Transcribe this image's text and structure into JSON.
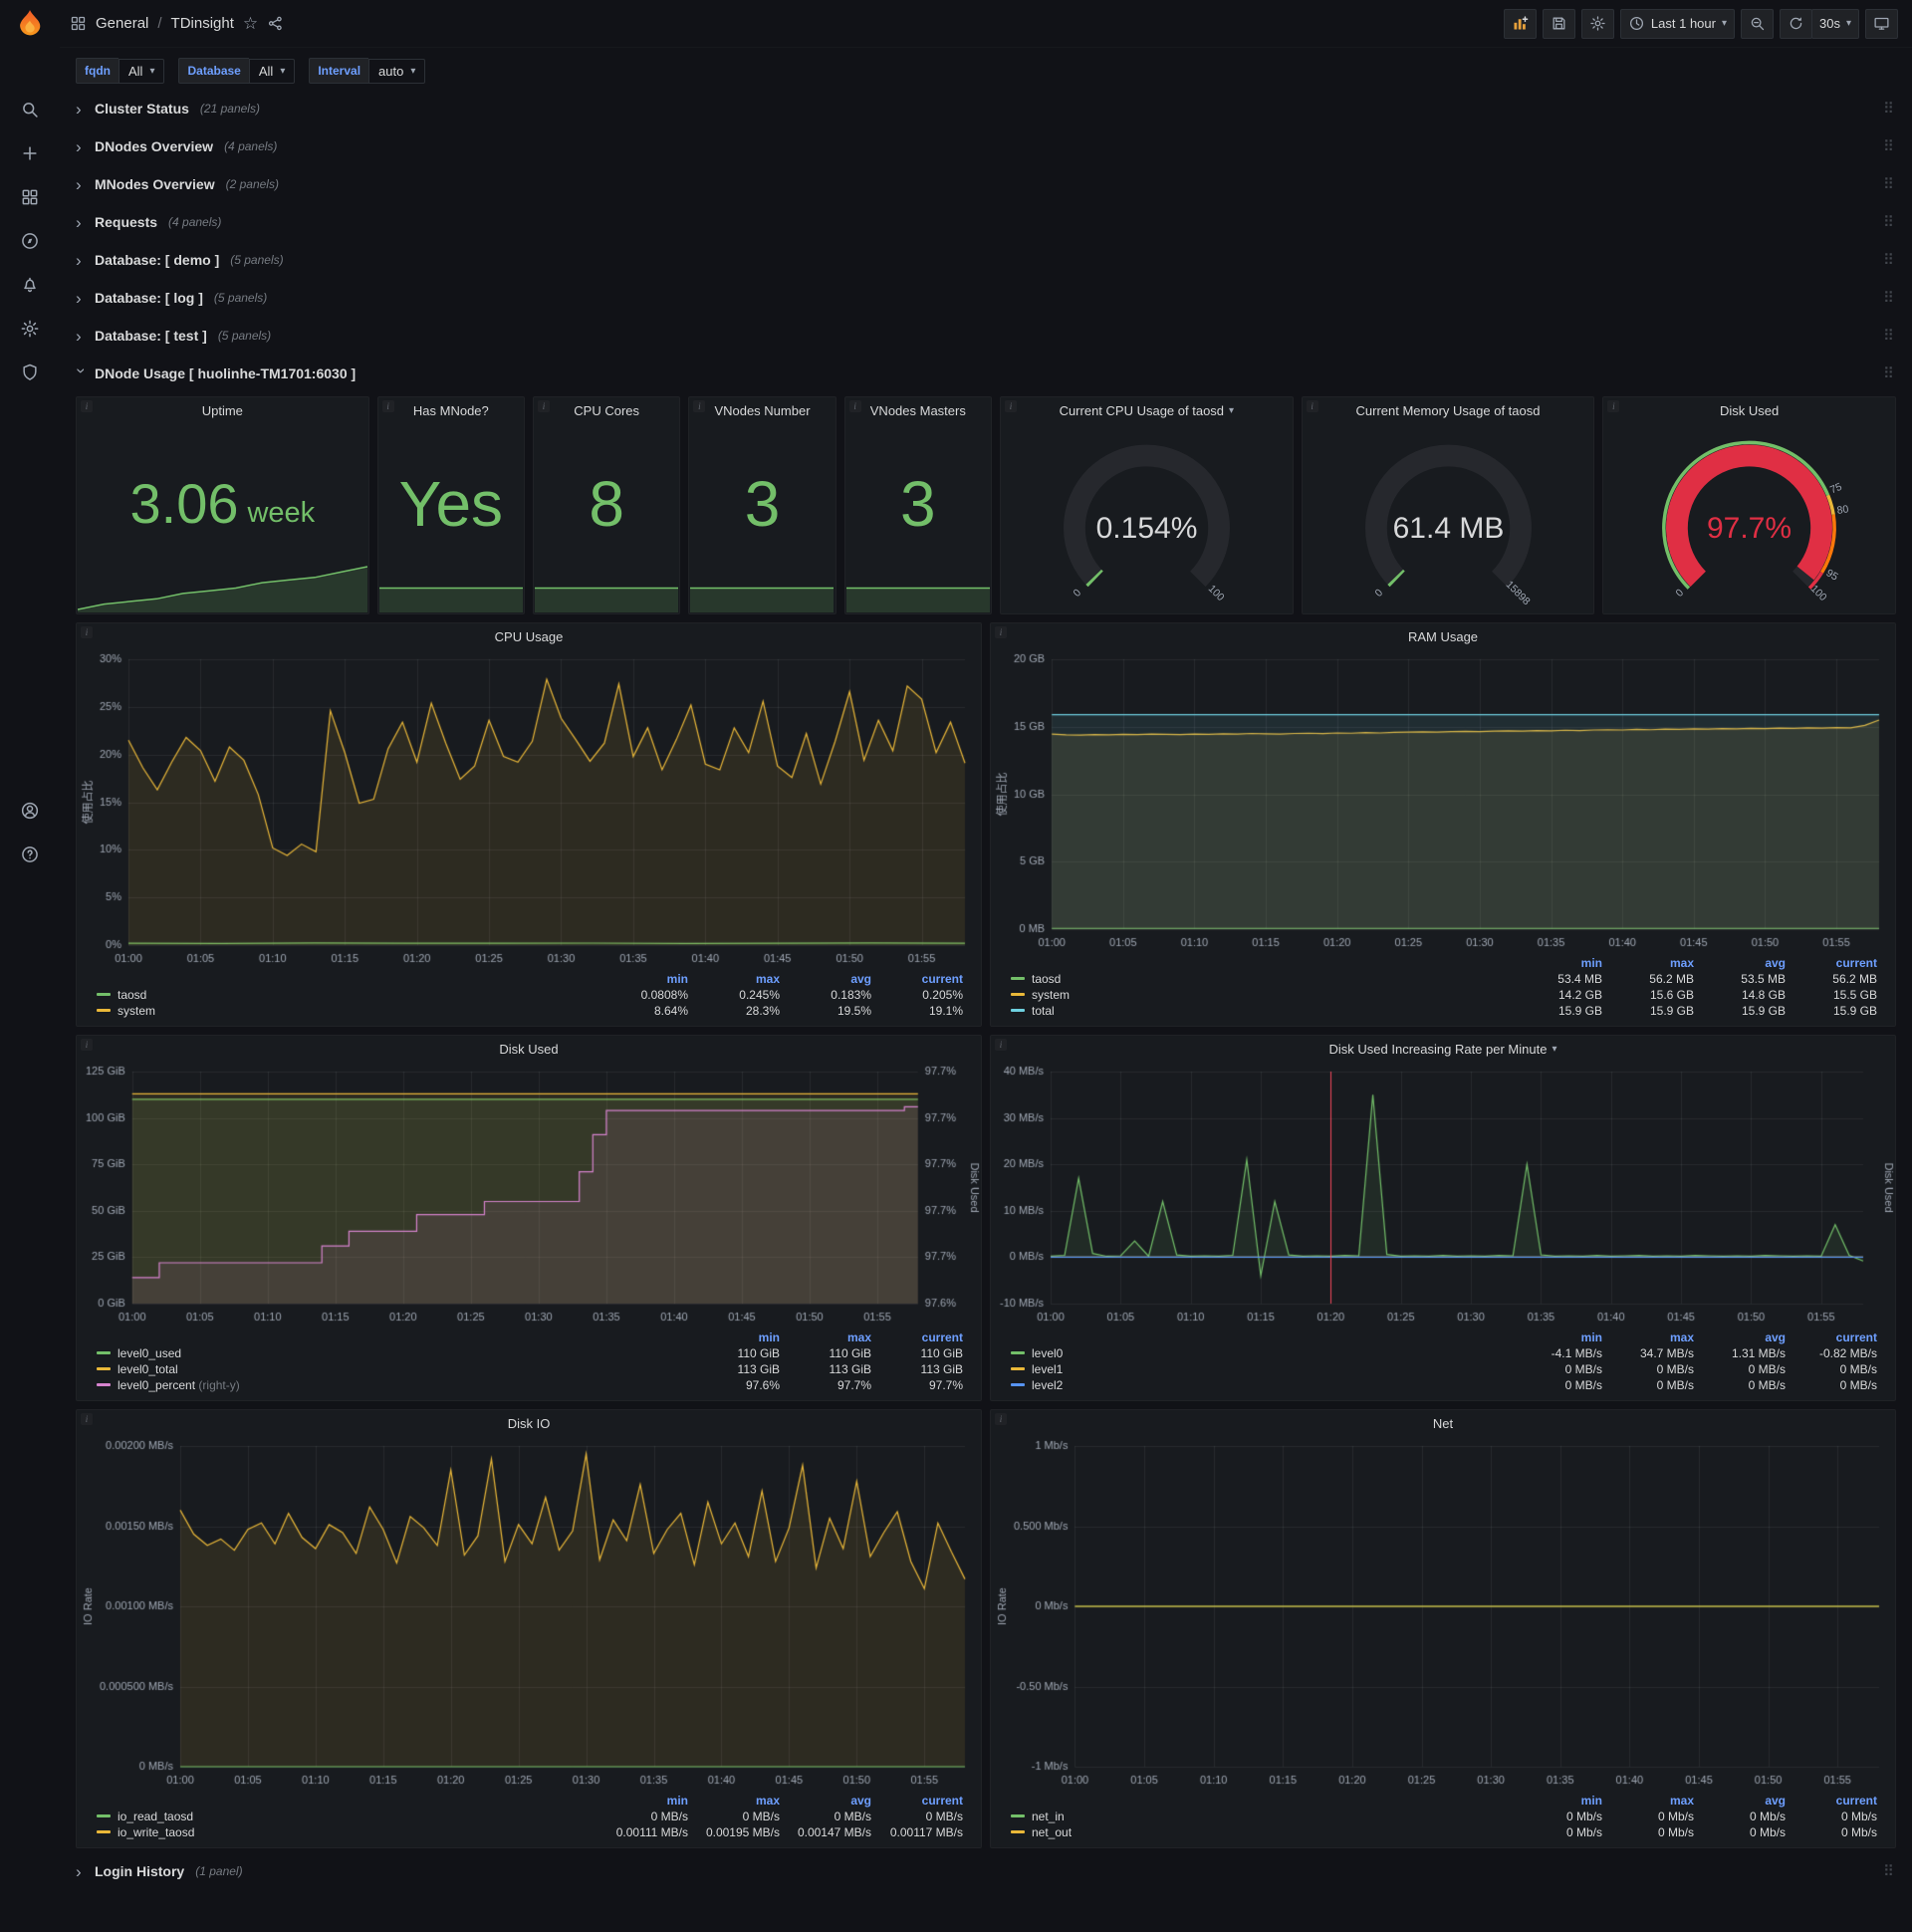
{
  "icons": {
    "chevron": "›",
    "caret_down": "▾",
    "handle": "⠿",
    "star": "☆",
    "info": "i"
  },
  "topnav": {
    "breadcrumb": {
      "section": "General",
      "separator": "/",
      "page": "TDinsight"
    },
    "time_range": "Last 1 hour",
    "refresh_interval": "30s"
  },
  "variables": [
    {
      "label": "fqdn",
      "value": "All"
    },
    {
      "label": "Database",
      "value": "All"
    },
    {
      "label": "Interval",
      "value": "auto"
    }
  ],
  "collapsed_rows": [
    {
      "label": "Cluster Status",
      "count": "(21 panels)"
    },
    {
      "label": "DNodes Overview",
      "count": "(4 panels)"
    },
    {
      "label": "MNodes Overview",
      "count": "(2 panels)"
    },
    {
      "label": "Requests",
      "count": "(4 panels)"
    },
    {
      "label": "Database: [ demo ]",
      "count": "(5 panels)"
    },
    {
      "label": "Database: [ log ]",
      "count": "(5 panels)"
    },
    {
      "label": "Database: [ test ]",
      "count": "(5 panels)"
    }
  ],
  "expanded_row": {
    "label": "DNode Usage [ huolinhe-TM1701:6030 ]"
  },
  "footer_row": {
    "label": "Login History",
    "count": "(1 panel)"
  },
  "stats": [
    {
      "title": "Uptime",
      "value": "3.06",
      "unit": "week",
      "spark": [
        2.98,
        2.99,
        2.995,
        3.0,
        3.01,
        3.015,
        3.02,
        3.03,
        3.035,
        3.04,
        3.05,
        3.06
      ]
    },
    {
      "title": "Has MNode?",
      "value": "Yes",
      "spark": [
        1,
        1
      ]
    },
    {
      "title": "CPU Cores",
      "value": "8",
      "spark": [
        8,
        8
      ]
    },
    {
      "title": "VNodes Number",
      "value": "3",
      "spark": [
        3,
        3
      ]
    },
    {
      "title": "VNodes Masters",
      "value": "3",
      "spark": [
        3,
        3
      ]
    }
  ],
  "gauges": [
    {
      "title": "Current CPU Usage of taosd",
      "title_chevron": true,
      "value": "0.154%",
      "pct": 0.00154,
      "value_color": "#d8d9da",
      "arc_color": "#73bf69",
      "labels": [
        {
          "t": "0",
          "p": 0
        },
        {
          "t": "100",
          "p": 1
        }
      ],
      "thresholds": [
        {
          "p": 0,
          "color": "#73bf69"
        }
      ]
    },
    {
      "title": "Current Memory Usage of taosd",
      "value": "61.4 MB",
      "pct": 0.0039,
      "value_color": "#d8d9da",
      "arc_color": "#73bf69",
      "labels": [
        {
          "t": "0",
          "p": 0
        },
        {
          "t": "15898",
          "p": 1
        }
      ],
      "thresholds": [
        {
          "p": 0,
          "color": "#73bf69"
        }
      ]
    },
    {
      "title": "Disk Used",
      "value": "97.7%",
      "pct": 0.977,
      "value_color": "#e02f44",
      "arc_color": "#e02f44",
      "labels": [
        {
          "t": "0",
          "p": 0
        },
        {
          "t": "75",
          "p": 0.75
        },
        {
          "t": "80",
          "p": 0.8
        },
        {
          "t": "95",
          "p": 0.95
        },
        {
          "t": "100",
          "p": 1
        }
      ],
      "thresholds": [
        {
          "p": 0,
          "color": "#73bf69"
        },
        {
          "p": 0.75,
          "color": "#eab839"
        },
        {
          "p": 0.8,
          "color": "#ff780a"
        },
        {
          "p": 0.95,
          "color": "#e02f44"
        }
      ]
    }
  ],
  "time_axis": {
    "min": 0,
    "max": 58,
    "ticks": [
      {
        "v": 0,
        "label": "01:00"
      },
      {
        "v": 5,
        "label": "01:05"
      },
      {
        "v": 10,
        "label": "01:10"
      },
      {
        "v": 15,
        "label": "01:15"
      },
      {
        "v": 20,
        "label": "01:20"
      },
      {
        "v": 25,
        "label": "01:25"
      },
      {
        "v": 30,
        "label": "01:30"
      },
      {
        "v": 35,
        "label": "01:35"
      },
      {
        "v": 40,
        "label": "01:40"
      },
      {
        "v": 45,
        "label": "01:45"
      },
      {
        "v": 50,
        "label": "01:50"
      },
      {
        "v": 55,
        "label": "01:55"
      }
    ]
  },
  "charts": [
    {
      "title": "CPU Usage",
      "y_label": "使用占比",
      "y_min": 0,
      "y_max": 30,
      "y_ticks": [
        {
          "v": 0,
          "label": "0%"
        },
        {
          "v": 5,
          "label": "5%"
        },
        {
          "v": 10,
          "label": "10%"
        },
        {
          "v": 15,
          "label": "15%"
        },
        {
          "v": 20,
          "label": "20%"
        },
        {
          "v": 25,
          "label": "25%"
        },
        {
          "v": 30,
          "label": "30%"
        }
      ],
      "legend_cols": [
        "min",
        "max",
        "avg",
        "current"
      ],
      "series": [
        {
          "name": "taosd",
          "color": "#73bf69",
          "stats": [
            "0.0808%",
            "0.245%",
            "0.183%",
            "0.205%"
          ],
          "points": [
            0.2,
            0.18,
            0.22,
            0.19,
            0.2,
            0.21,
            0.18,
            0.2,
            0.22,
            0.2
          ]
        },
        {
          "name": "system",
          "color": "#eab839",
          "stats": [
            "8.64%",
            "28.3%",
            "19.5%",
            "19.1%"
          ],
          "points": [
            21.5,
            18.6,
            16.3,
            19.2,
            21.8,
            20.4,
            17.2,
            20.8,
            19.4,
            15.8,
            10.2,
            9.4,
            10.6,
            9.8,
            24.6,
            20.2,
            14.9,
            15.3,
            20.6,
            23.4,
            19.2,
            25.4,
            21.2,
            17.4,
            18.8,
            23.6,
            19.8,
            19.2,
            21.4,
            27.9,
            23.8,
            21.6,
            19.3,
            21.2,
            27.4,
            19.8,
            22.8,
            18.4,
            21.6,
            25.2,
            19.0,
            18.4,
            22.8,
            20.2,
            25.6,
            18.8,
            17.6,
            22.2,
            16.9,
            21.4,
            26.6,
            19.4,
            23.6,
            20.4,
            27.2,
            25.8,
            20.2,
            23.4,
            19.1
          ]
        }
      ]
    },
    {
      "title": "RAM Usage",
      "y_label": "使用占比",
      "y_min": 0,
      "y_max": 20,
      "y_ticks": [
        {
          "v": 0,
          "label": "0 MB"
        },
        {
          "v": 5,
          "label": "5 GB"
        },
        {
          "v": 10,
          "label": "10 GB"
        },
        {
          "v": 15,
          "label": "15 GB"
        },
        {
          "v": 20,
          "label": "20 GB"
        }
      ],
      "legend_cols": [
        "min",
        "max",
        "avg",
        "current"
      ],
      "series": [
        {
          "name": "taosd",
          "color": "#73bf69",
          "stats": [
            "53.4 MB",
            "56.2 MB",
            "53.5 MB",
            "56.2 MB"
          ],
          "points": [
            0.054,
            0.054
          ]
        },
        {
          "name": "system",
          "color": "#eab839",
          "stats": [
            "14.2 GB",
            "15.6 GB",
            "14.8 GB",
            "15.5 GB"
          ],
          "points": [
            14.45,
            14.4,
            14.38,
            14.42,
            14.4,
            14.44,
            14.42,
            14.46,
            14.44,
            14.42,
            14.46,
            14.44,
            14.48,
            14.46,
            14.5,
            14.48,
            14.46,
            14.5,
            14.52,
            14.5,
            14.54,
            14.52,
            14.56,
            14.54,
            14.58,
            14.6,
            14.62,
            14.6,
            14.64,
            14.66,
            14.64,
            14.68,
            14.7,
            14.68,
            14.72,
            14.7,
            14.74,
            14.72,
            14.76,
            14.78,
            14.76,
            14.8,
            14.78,
            14.82,
            14.8,
            14.84,
            14.82,
            14.86,
            14.84,
            14.88,
            14.86,
            14.9,
            14.88,
            14.92,
            14.9,
            14.94,
            14.92,
            15.1,
            15.5
          ]
        },
        {
          "name": "total",
          "color": "#6ed0e0",
          "stats": [
            "15.9 GB",
            "15.9 GB",
            "15.9 GB",
            "15.9 GB"
          ],
          "points": [
            15.9,
            15.9
          ]
        }
      ]
    },
    {
      "title": "Disk Used",
      "y_min": 0,
      "y_max": 125,
      "y_ticks": [
        {
          "v": 0,
          "label": "0 GiB"
        },
        {
          "v": 25,
          "label": "25 GiB"
        },
        {
          "v": 50,
          "label": "50 GiB"
        },
        {
          "v": 75,
          "label": "75 GiB"
        },
        {
          "v": 100,
          "label": "100 GiB"
        },
        {
          "v": 125,
          "label": "125 GiB"
        }
      ],
      "right_axis": {
        "min": 97.597,
        "max": 97.722,
        "label": "Disk Used",
        "tick_labels": [
          "97.6%",
          "97.7%",
          "97.7%",
          "97.7%",
          "97.7%",
          "97.7%"
        ]
      },
      "legend_cols": [
        "min",
        "max",
        "current"
      ],
      "series": [
        {
          "name": "level0_used",
          "color": "#73bf69",
          "stats": [
            "110 GiB",
            "110 GiB",
            "110 GiB"
          ],
          "points": [
            110,
            110
          ]
        },
        {
          "name": "level0_total",
          "color": "#eab839",
          "stats": [
            "113 GiB",
            "113 GiB",
            "113 GiB"
          ],
          "points": [
            113,
            113
          ]
        },
        {
          "name": "level0_percent",
          "name_suffix": "(right-y)",
          "color": "#d683ce",
          "axis": "right",
          "step": true,
          "stats": [
            "97.6%",
            "97.7%",
            "97.7%"
          ],
          "points": [
            97.611,
            97.611,
            97.619,
            97.619,
            97.619,
            97.619,
            97.619,
            97.619,
            97.619,
            97.619,
            97.619,
            97.619,
            97.619,
            97.619,
            97.628,
            97.628,
            97.636,
            97.636,
            97.636,
            97.636,
            97.636,
            97.645,
            97.645,
            97.645,
            97.645,
            97.645,
            97.652,
            97.652,
            97.652,
            97.652,
            97.652,
            97.652,
            97.652,
            97.668,
            97.688,
            97.701,
            97.701,
            97.701,
            97.701,
            97.701,
            97.701,
            97.701,
            97.701,
            97.701,
            97.701,
            97.701,
            97.701,
            97.701,
            97.701,
            97.701,
            97.701,
            97.701,
            97.701,
            97.701,
            97.701,
            97.701,
            97.701,
            97.703,
            97.703
          ]
        }
      ]
    },
    {
      "title": "Disk Used Increasing Rate per Minute",
      "title_chevron": true,
      "y_min": -10,
      "y_max": 40,
      "y_ticks": [
        {
          "v": -10,
          "label": "-10 MB/s"
        },
        {
          "v": 0,
          "label": "0 MB/s"
        },
        {
          "v": 10,
          "label": "10 MB/s"
        },
        {
          "v": 20,
          "label": "20 MB/s"
        },
        {
          "v": 30,
          "label": "30 MB/s"
        },
        {
          "v": 40,
          "label": "40 MB/s"
        }
      ],
      "right_axis": {
        "min": 0,
        "max": 1,
        "label": "Disk Used",
        "tick_labels": []
      },
      "annotation_x": 20,
      "legend_cols": [
        "min",
        "max",
        "avg",
        "current"
      ],
      "series": [
        {
          "name": "level0",
          "color": "#73bf69",
          "stats": [
            "-4.1 MB/s",
            "34.7 MB/s",
            "1.31 MB/s",
            "-0.82 MB/s"
          ],
          "points": [
            0.2,
            0.4,
            17,
            0.8,
            0.2,
            0.3,
            3.5,
            0.2,
            12,
            0.5,
            0.2,
            0.3,
            0.2,
            0.4,
            21,
            -4,
            12,
            0.5,
            0.2,
            0.3,
            0.2,
            0.4,
            0.3,
            35,
            0.6,
            0.2,
            0.3,
            0.2,
            0.4,
            0.2,
            0.3,
            0.2,
            0.4,
            0.3,
            20,
            0.5,
            0.2,
            0.3,
            0.2,
            0.4,
            0.2,
            0.3,
            0.4,
            0.2,
            0.3,
            0.2,
            0.4,
            0.3,
            0.2,
            0.3,
            0.2,
            0.4,
            0.3,
            0.2,
            0.3,
            0.2,
            7,
            0.4,
            -0.82
          ]
        },
        {
          "name": "level1",
          "color": "#eab839",
          "stats": [
            "0 MB/s",
            "0 MB/s",
            "0 MB/s",
            "0 MB/s"
          ],
          "points": [
            0,
            0
          ]
        },
        {
          "name": "level2",
          "color": "#5794f2",
          "stats": [
            "0 MB/s",
            "0 MB/s",
            "0 MB/s",
            "0 MB/s"
          ],
          "points": [
            0,
            0
          ]
        }
      ]
    },
    {
      "title": "Disk IO",
      "y_label": "IO Rate",
      "y_min": 0,
      "y_max": 0.002,
      "y_ticks": [
        {
          "v": 0,
          "label": "0 MB/s"
        },
        {
          "v": 0.0005,
          "label": "0.000500 MB/s"
        },
        {
          "v": 0.001,
          "label": "0.00100 MB/s"
        },
        {
          "v": 0.0015,
          "label": "0.00150 MB/s"
        },
        {
          "v": 0.002,
          "label": "0.00200 MB/s"
        }
      ],
      "legend_cols": [
        "min",
        "max",
        "avg",
        "current"
      ],
      "series": [
        {
          "name": "io_read_taosd",
          "color": "#73bf69",
          "stats": [
            "0 MB/s",
            "0 MB/s",
            "0 MB/s",
            "0 MB/s"
          ],
          "points": [
            0,
            0
          ]
        },
        {
          "name": "io_write_taosd",
          "color": "#eab839",
          "stats": [
            "0.00111 MB/s",
            "0.00195 MB/s",
            "0.00147 MB/s",
            "0.00117 MB/s"
          ],
          "points": [
            0.0016,
            0.00145,
            0.00138,
            0.00142,
            0.00135,
            0.00148,
            0.00152,
            0.00139,
            0.00158,
            0.00143,
            0.00136,
            0.00151,
            0.00146,
            0.00133,
            0.00162,
            0.00148,
            0.00127,
            0.00156,
            0.00149,
            0.00138,
            0.00185,
            0.00132,
            0.00144,
            0.00192,
            0.00128,
            0.00151,
            0.00139,
            0.00168,
            0.00135,
            0.00147,
            0.00195,
            0.00129,
            0.00154,
            0.00141,
            0.00176,
            0.00133,
            0.00148,
            0.00158,
            0.00126,
            0.00165,
            0.00139,
            0.00152,
            0.00131,
            0.00172,
            0.00128,
            0.00149,
            0.00188,
            0.00124,
            0.00155,
            0.00136,
            0.00178,
            0.00131,
            0.00146,
            0.00159,
            0.00128,
            0.00111,
            0.00152,
            0.00134,
            0.00117
          ]
        }
      ]
    },
    {
      "title": "Net",
      "y_label": "IO Rate",
      "y_min": -1,
      "y_max": 1,
      "y_ticks": [
        {
          "v": -1,
          "label": "-1 Mb/s"
        },
        {
          "v": -0.5,
          "label": "-0.50 Mb/s"
        },
        {
          "v": 0,
          "label": "0 Mb/s"
        },
        {
          "v": 0.5,
          "label": "0.500 Mb/s"
        },
        {
          "v": 1,
          "label": "1 Mb/s"
        }
      ],
      "legend_cols": [
        "min",
        "max",
        "avg",
        "current"
      ],
      "series": [
        {
          "name": "net_in",
          "color": "#73bf69",
          "stats": [
            "0 Mb/s",
            "0 Mb/s",
            "0 Mb/s",
            "0 Mb/s"
          ],
          "points": [
            0,
            0
          ]
        },
        {
          "name": "net_out",
          "color": "#eab839",
          "stats": [
            "0 Mb/s",
            "0 Mb/s",
            "0 Mb/s",
            "0 Mb/s"
          ],
          "points": [
            0,
            0
          ]
        }
      ]
    }
  ]
}
